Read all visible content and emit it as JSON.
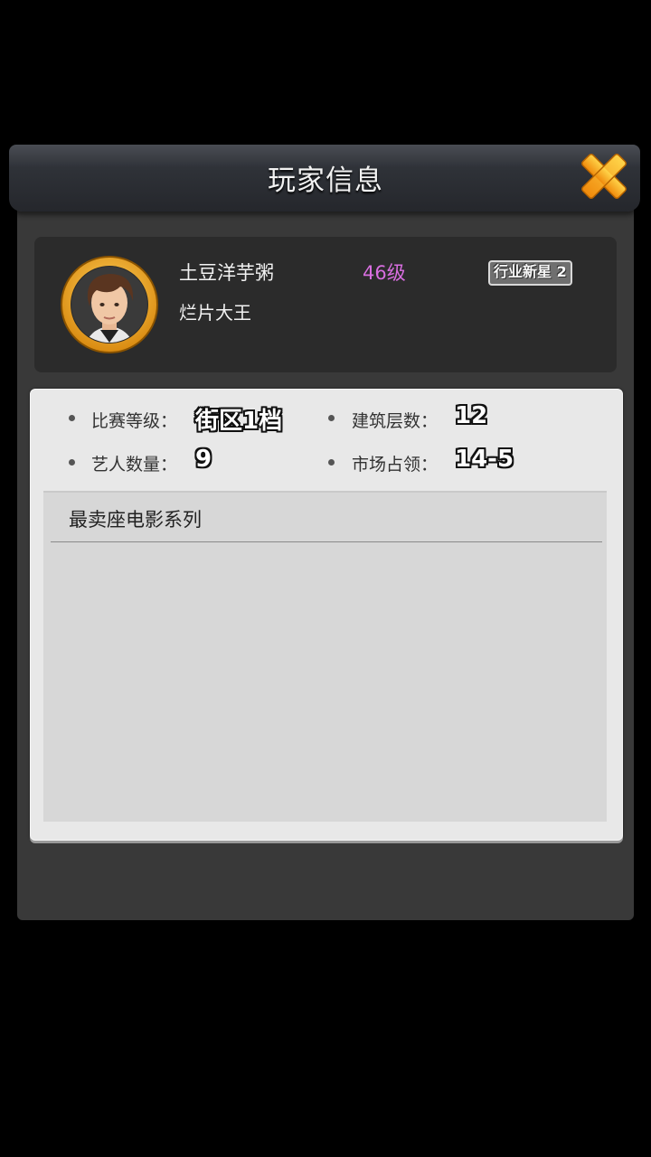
{
  "dialog": {
    "title": "玩家信息",
    "close_icon": "close-x-icon"
  },
  "player": {
    "name": "土豆洋芋粥",
    "level": "46级",
    "rank_badge": "行业新星 2",
    "title": "烂片大王",
    "avatar_icon": "player-avatar",
    "level_color": "#d86ee0"
  },
  "stats": {
    "match_level_label": "比赛等级：",
    "match_level_value": "街区1档",
    "building_floors_label": "建筑层数：",
    "building_floors_value": "12",
    "artists_label": "艺人数量：",
    "artists_value": "9",
    "market_share_label": "市场占领：",
    "market_share_value": "14-5"
  },
  "list": {
    "header": "最卖座电影系列"
  },
  "colors": {
    "close_button": "#f6a623",
    "avatar_ring": "#e9a21f"
  }
}
